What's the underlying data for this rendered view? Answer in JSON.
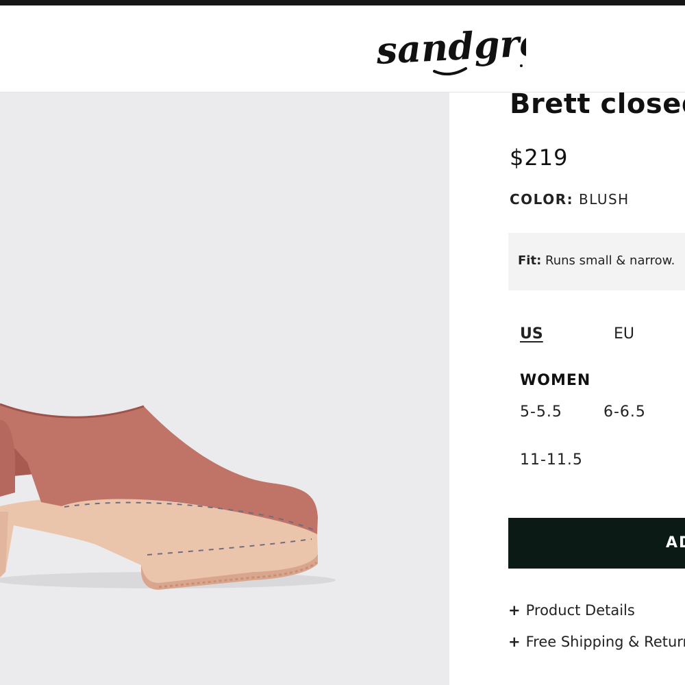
{
  "header": {
    "logo_text": "sandgrens"
  },
  "product": {
    "title": "Brett closed",
    "price": "$219",
    "color_label": "COLOR:",
    "color_value": "BLUSH",
    "fit_label": "Fit:",
    "fit_text": "Runs small & narrow."
  },
  "size_selector": {
    "units": [
      "US",
      "EU"
    ],
    "selected_unit": "US",
    "section_title": "WOMEN",
    "sizes": [
      "5-5.5",
      "6-6.5",
      "11-11.5"
    ]
  },
  "cart": {
    "add_label": "AD"
  },
  "accordions": [
    {
      "symbol": "+",
      "label": "Product Details"
    },
    {
      "symbol": "+",
      "label": "Free Shipping & Return"
    }
  ],
  "colors": {
    "button_bg": "#0b1a14",
    "leather": "#c07468",
    "wood": "#ebc4ac",
    "gallery_bg": "#ebebed"
  },
  "gallery": {
    "image_subject": "blush leather clog with wooden heel"
  }
}
